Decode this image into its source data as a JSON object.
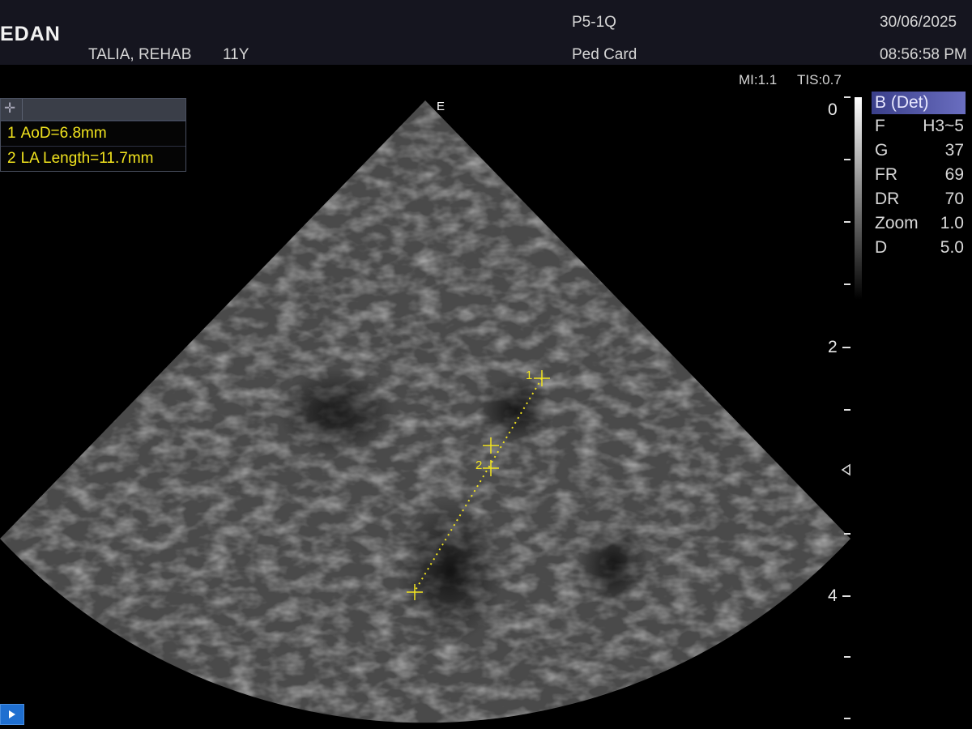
{
  "header": {
    "brand": "EDAN",
    "patient_name": "TALIA, REHAB",
    "patient_age": "11Y",
    "probe": "P5-1Q",
    "preset": "Ped Card",
    "date": "30/06/2025",
    "time": "08:56:58 PM"
  },
  "indices": {
    "mi": "MI:1.1",
    "tis": "TIS:0.7"
  },
  "measurements": [
    {
      "index": "1",
      "text": "AoD=6.8mm"
    },
    {
      "index": "2",
      "text": "LA Length=11.7mm"
    }
  ],
  "image_params": {
    "mode": "B (Det)",
    "rows": [
      {
        "key": "F",
        "value": "H3~5"
      },
      {
        "key": "G",
        "value": "37"
      },
      {
        "key": "FR",
        "value": "69"
      },
      {
        "key": "DR",
        "value": "70"
      },
      {
        "key": "Zoom",
        "value": "1.0"
      },
      {
        "key": "D",
        "value": "5.0"
      }
    ]
  },
  "depth_scale": {
    "labels": [
      "0",
      "2",
      "4"
    ]
  },
  "probe_marker": "E",
  "caliper_labels": [
    "1",
    "2"
  ],
  "colors": {
    "caliper": "#f2e41e",
    "header_bg": "#15151f",
    "highlight": "#4a50a8"
  },
  "icons": [
    "crosshair-icon",
    "focus-marker-icon",
    "play-icon"
  ]
}
